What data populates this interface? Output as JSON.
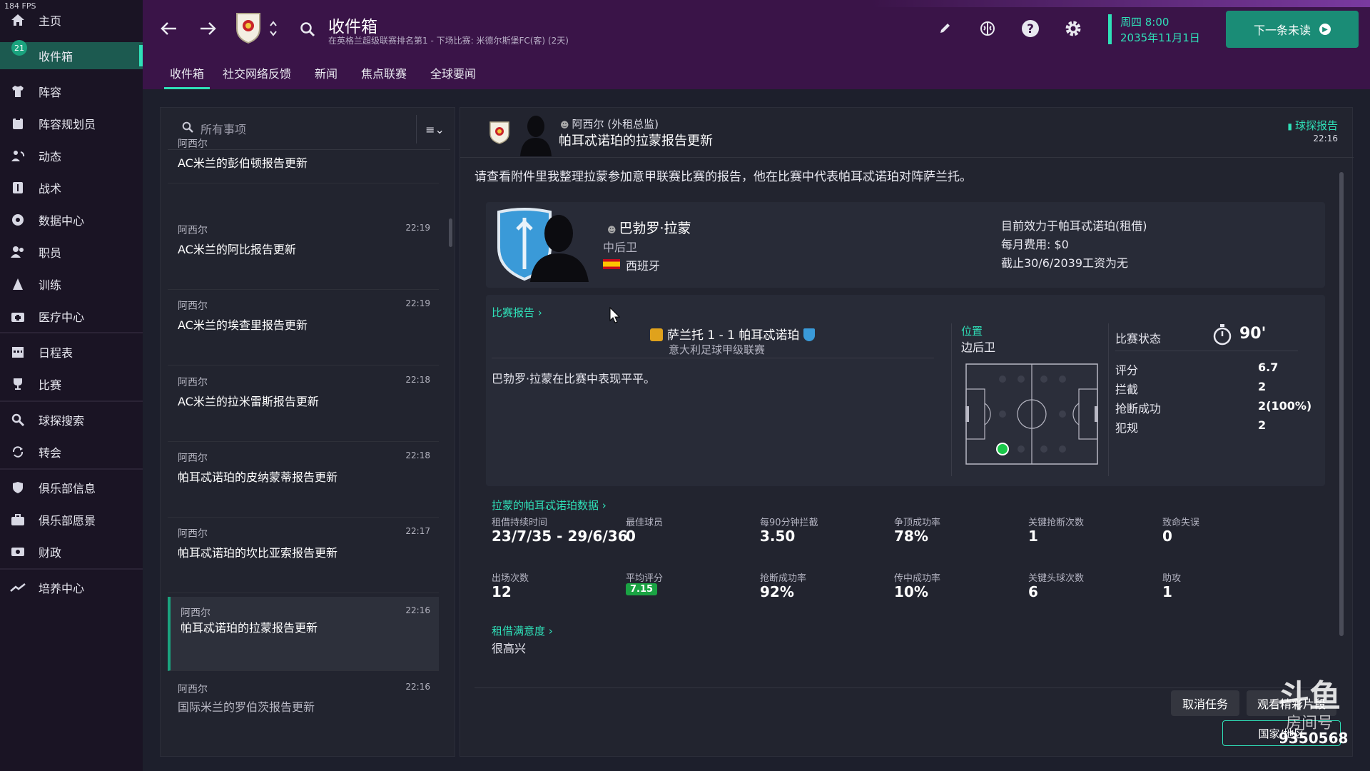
{
  "fps": "184 FPS",
  "sidebar": {
    "badge": "21",
    "items": [
      {
        "label": "主页"
      },
      {
        "label": "收件箱"
      },
      {
        "label": "阵容"
      },
      {
        "label": "阵容规划员"
      },
      {
        "label": "动态"
      },
      {
        "label": "战术"
      },
      {
        "label": "数据中心"
      },
      {
        "label": "职员"
      },
      {
        "label": "训练"
      },
      {
        "label": "医疗中心"
      },
      {
        "label": "日程表"
      },
      {
        "label": "比赛"
      },
      {
        "label": "球探搜索"
      },
      {
        "label": "转会"
      },
      {
        "label": "俱乐部信息"
      },
      {
        "label": "俱乐部愿景"
      },
      {
        "label": "财政"
      },
      {
        "label": "培养中心"
      }
    ]
  },
  "header": {
    "title": "收件箱",
    "subtitle": "在英格兰超级联赛排名第1 - 下场比赛: 米德尔斯堡FC(客) (2天)",
    "tabs": [
      "收件箱",
      "社交网络反馈",
      "新闻",
      "焦点联赛",
      "全球要闻"
    ],
    "date_day": "周四 8:00",
    "date_full": "2035年11月1日",
    "next_button": "下一条未读"
  },
  "list": {
    "search_placeholder": "所有事项",
    "messages": [
      {
        "sender": "阿西尔",
        "time": "",
        "subject": "AC米兰的彭伯顿报告更新"
      },
      {
        "sender": "阿西尔",
        "time": "22:19",
        "subject": "AC米兰的阿比报告更新"
      },
      {
        "sender": "阿西尔",
        "time": "22:19",
        "subject": "AC米兰的埃查里报告更新"
      },
      {
        "sender": "阿西尔",
        "time": "22:18",
        "subject": "AC米兰的拉米雷斯报告更新"
      },
      {
        "sender": "阿西尔",
        "time": "22:18",
        "subject": "帕耳忒诺珀的皮纳蒙蒂报告更新"
      },
      {
        "sender": "阿西尔",
        "time": "22:17",
        "subject": "帕耳忒诺珀的坎比亚索报告更新"
      },
      {
        "sender": "阿西尔",
        "time": "22:16",
        "subject": "帕耳忒诺珀的拉蒙报告更新"
      },
      {
        "sender": "阿西尔",
        "time": "22:16",
        "subject": "国际米兰的罗伯茨报告更新"
      }
    ]
  },
  "message": {
    "sender": "阿西尔 (外租总监)",
    "title": "帕耳忒诺珀的拉蒙报告更新",
    "tag": "球探报告",
    "time": "22:16",
    "body": "请查看附件里我整理拉蒙参加意甲联赛比赛的报告，他在比赛中代表帕耳忒诺珀对阵萨兰托。",
    "player": {
      "name": "巴勃罗·拉蒙",
      "position": "中后卫",
      "nationality": "西班牙",
      "club_info": "目前效力于帕耳忒诺珀(租借)",
      "monthly_fee": "每月费用: $0",
      "wage_info": "截止30/6/2039工资为无"
    },
    "match": {
      "link": "比赛报告",
      "score": "萨兰托 1 - 1 帕耳忒诺珀",
      "competition": "意大利足球甲级联赛",
      "summary": "巴勃罗·拉蒙在比赛中表现平平。",
      "position_label": "位置",
      "position_value": "边后卫",
      "status_label": "比赛状态",
      "minutes": "90'",
      "stats": [
        {
          "label": "评分",
          "value": "6.7"
        },
        {
          "label": "拦截",
          "value": "2"
        },
        {
          "label": "抢断成功",
          "value": "2(100%)"
        },
        {
          "label": "犯规",
          "value": "2"
        }
      ]
    },
    "loan_data": {
      "link": "拉蒙的帕耳忒诺珀数据",
      "row1": [
        {
          "label": "租借持续时间",
          "value": "23/7/35 - 29/6/36"
        },
        {
          "label": "最佳球员",
          "value": "0"
        },
        {
          "label": "每90分钟拦截",
          "value": "3.50"
        },
        {
          "label": "争顶成功率",
          "value": "78%"
        },
        {
          "label": "关键抢断次数",
          "value": "1"
        },
        {
          "label": "致命失误",
          "value": "0"
        }
      ],
      "row2": [
        {
          "label": "出场次数",
          "value": "12"
        },
        {
          "label": "平均评分",
          "value": "7.15"
        },
        {
          "label": "抢断成功率",
          "value": "92%"
        },
        {
          "label": "传中成功率",
          "value": "10%"
        },
        {
          "label": "关键头球次数",
          "value": "6"
        },
        {
          "label": "助攻",
          "value": "1"
        }
      ]
    },
    "satisfaction": {
      "link": "租借满意度",
      "value": "很高兴"
    },
    "buttons": {
      "cancel": "取消任务",
      "highlights": "观看精彩片段",
      "country": "国家/地区"
    }
  },
  "watermark": {
    "code": "9350568"
  },
  "colors": {
    "accent": "#2fe0b8",
    "header": "#3a1448",
    "sidebar": "#1a1424",
    "panel": "#22242f"
  }
}
